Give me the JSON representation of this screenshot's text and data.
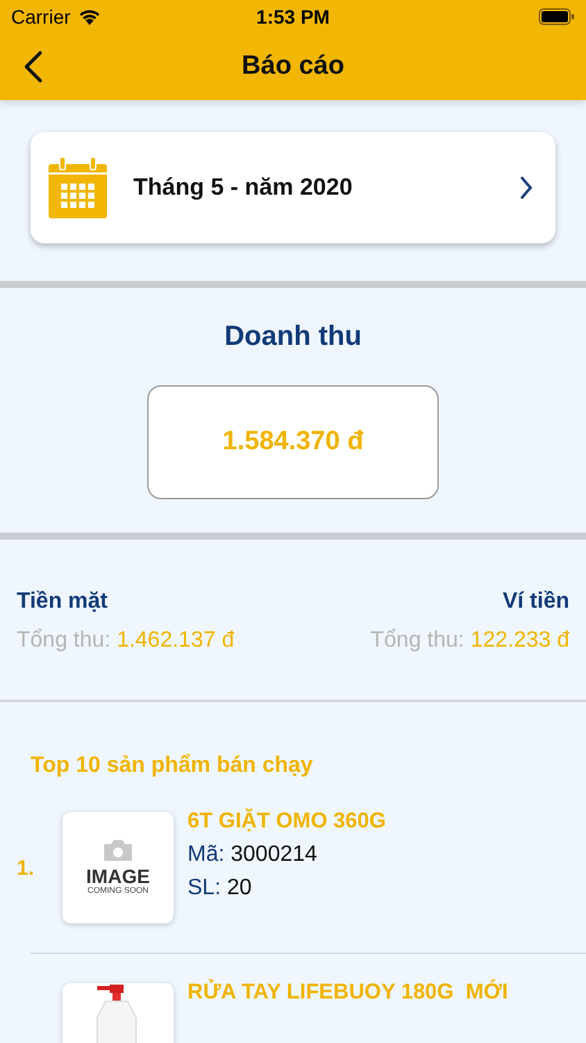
{
  "status_bar": {
    "carrier": "Carrier",
    "time": "1:53 PM"
  },
  "nav": {
    "title": "Báo cáo"
  },
  "period": {
    "label": "Tháng 5 - năm 2020"
  },
  "revenue": {
    "title": "Doanh thu",
    "amount": "1.584.370 đ"
  },
  "payments": [
    {
      "title": "Tiền mặt",
      "label": "Tổng thu:",
      "amount": "1.462.137 đ"
    },
    {
      "title": "Ví tiền",
      "label": "Tổng thu:",
      "amount": "122.233 đ"
    }
  ],
  "top_products": {
    "title": "Top 10 sản phẩm bán chạy",
    "items": [
      {
        "rank": "1.",
        "image": {
          "kind": "placeholder",
          "line_1": "IMAGE",
          "line_2": "COMING SOON"
        },
        "name": "6T GIẶT OMO 360G",
        "code_label": "Mã:",
        "code": "3000214",
        "qty_label": "SL:",
        "qty": "20"
      },
      {
        "name": "RỬA TAY LIFEBUOY 180G  MỚI"
      }
    ]
  }
}
